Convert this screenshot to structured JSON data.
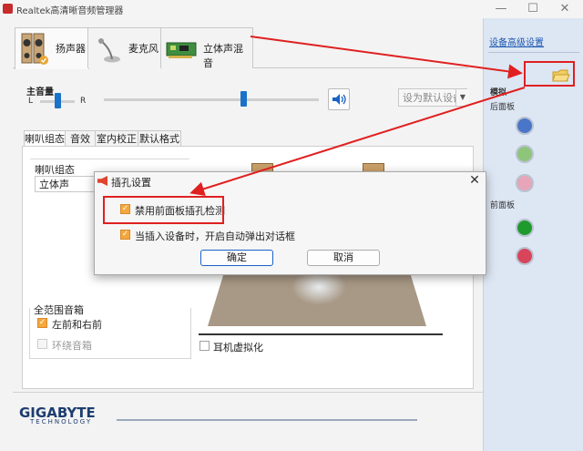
{
  "window": {
    "title": "Realtek高清晰音频管理器",
    "minimize": "—",
    "maximize": "☐",
    "close": "✕"
  },
  "device_tabs": [
    {
      "label": "扬声器",
      "icon": "speaker-icon",
      "active": true
    },
    {
      "label": "麦克风",
      "icon": "microphone-icon",
      "active": false
    },
    {
      "label": "立体声混音",
      "icon": "sound-card-icon",
      "active": false
    }
  ],
  "volume": {
    "label": "主音量",
    "left": "L",
    "right": "R",
    "balance": 0.5,
    "level": 0.68,
    "set_default": "设为默认设备"
  },
  "sub_tabs": [
    "喇叭组态",
    "音效",
    "室内校正",
    "默认格式"
  ],
  "speaker_config": {
    "group_label": "喇叭组态",
    "selected": "立体声"
  },
  "full_range": {
    "title": "全范围音箱",
    "front": "左前和右前",
    "front_checked": true,
    "surround": "环绕音箱",
    "surround_checked": false
  },
  "headphone_virtualization": "耳机虚拟化",
  "dialog": {
    "title": "插孔设置",
    "option1": "禁用前面板插孔检测",
    "option1_checked": true,
    "option2": "当插入设备时，开启自动弹出对话框",
    "option2_checked": true,
    "ok": "确定",
    "cancel": "取消"
  },
  "right_panel": {
    "advanced_link": "设备高级设置",
    "analog": "模拟",
    "back_panel": "后面板",
    "front_panel": "前面板",
    "colors": {
      "back": [
        "#4a76c9",
        "#8ec57a",
        "#e6a5b8"
      ],
      "front": [
        "#1f9a2d",
        "#d8455b"
      ]
    }
  },
  "footer": {
    "brand": "GIGABYTE",
    "tagline": "TECHNOLOGY"
  },
  "accent": {
    "annotation_red": "#e02020",
    "slider_blue": "#1a73c9",
    "checkbox_orange": "#f4a83c"
  }
}
